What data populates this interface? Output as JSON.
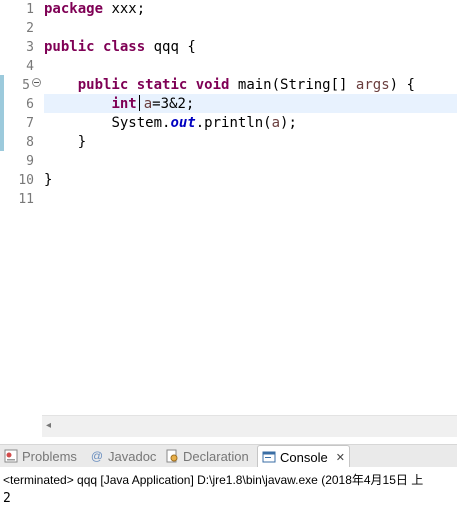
{
  "editor": {
    "line_numbers": [
      "1",
      "2",
      "3",
      "4",
      "5",
      "6",
      "7",
      "8",
      "9",
      "10",
      "11"
    ],
    "lines": {
      "l1": {
        "kw": "package",
        "rest": " xxx;"
      },
      "l3": {
        "kw1": "public",
        "kw2": "class",
        "rest": " qqq {"
      },
      "l5": {
        "indent": "    ",
        "kw1": "public",
        "kw2": "static",
        "kw3": "void",
        "mid": " main(String[] ",
        "var": "args",
        "rest": ") {"
      },
      "l6": {
        "indent": "        ",
        "kw": "int",
        "var": "a",
        "rest": "=3&2;"
      },
      "l7": {
        "indent": "        ",
        "pre": "System.",
        "field": "out",
        "mid": ".println(",
        "var": "a",
        "rest": ");"
      },
      "l8": {
        "text": "    }"
      },
      "l10": {
        "text": "}"
      }
    }
  },
  "scrollbar": {
    "left_arrow": "◂"
  },
  "tabs": [
    {
      "label": "Problems"
    },
    {
      "label": "Javadoc"
    },
    {
      "label": "Declaration"
    },
    {
      "label": "Console",
      "close": "✕"
    }
  ],
  "console": {
    "status": "<terminated> qqq [Java Application] D:\\jre1.8\\bin\\javaw.exe (2018年4月15日 上",
    "output": "2"
  },
  "colors": {
    "keyword": "#7f0055",
    "variable": "#6a3e3e",
    "field": "#0000c0",
    "current_line": "#e8f2fe"
  }
}
